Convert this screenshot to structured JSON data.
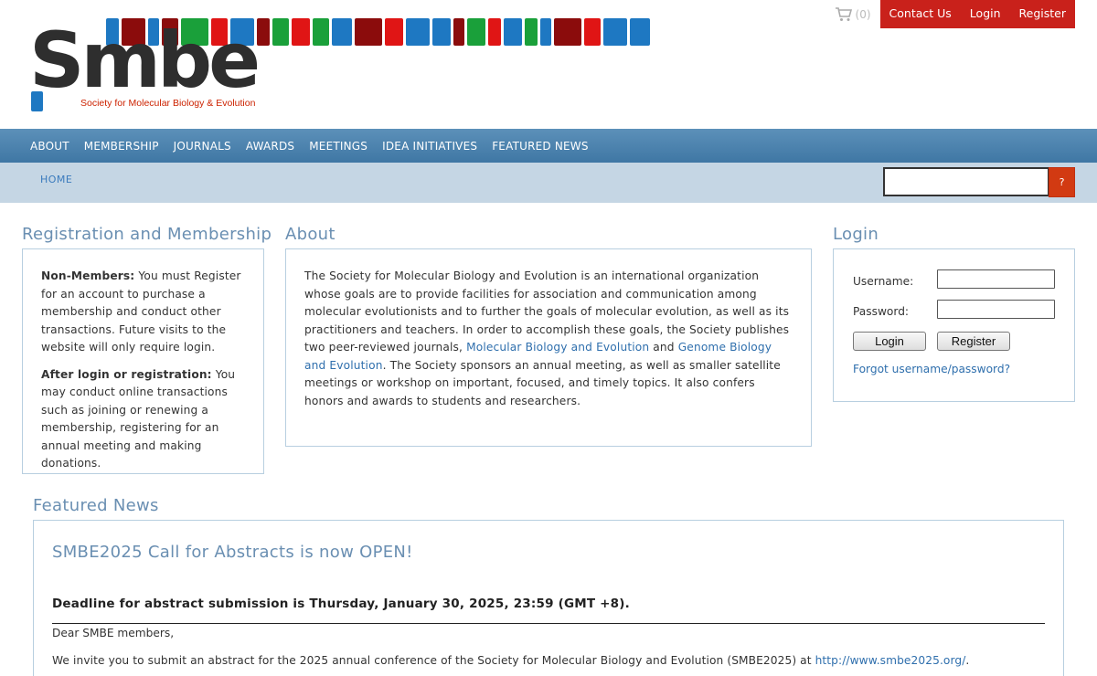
{
  "brand": {
    "wordmark": "Smbe",
    "tagline": "Society for Molecular Biology & Evolution",
    "bar_colors": [
      "#1e78c2",
      "#8b0c0c",
      "#1e78c2",
      "#8b0c0c",
      "#1aa03a",
      "#e01515",
      "#1e78c2",
      "#8b0c0c",
      "#1aa03a",
      "#e01515",
      "#1aa03a",
      "#1e78c2",
      "#8b0c0c",
      "#e01515",
      "#1e78c2",
      "#1e78c2",
      "#8b0c0c",
      "#1aa03a",
      "#e01515",
      "#1e78c2",
      "#1aa03a",
      "#1e78c2",
      "#8b0c0c",
      "#e01515",
      "#1e78c2",
      "#1e78c2"
    ]
  },
  "top_links": {
    "cart_count": "(0)",
    "contact": "Contact Us",
    "login": "Login",
    "register": "Register"
  },
  "nav": [
    "ABOUT",
    "MEMBERSHIP",
    "JOURNALS",
    "AWARDS",
    "MEETINGS",
    "IDEA INITIATIVES",
    "FEATURED NEWS"
  ],
  "breadcrumb": "HOME",
  "search": {
    "button_label": "?"
  },
  "registration": {
    "title": "Registration and Membership",
    "nonmember_label": "Non-Members:",
    "nonmember_text": " You must Register for an account to purchase a membership and conduct other transactions. Future visits to the website will only require login.",
    "after_label": "After login or registration:",
    "after_text": " You may conduct online transactions such as joining or renewing a membership, registering for an annual meeting and making donations."
  },
  "about": {
    "title": "About",
    "text_1": "The Society for Molecular Biology and Evolution is an international organization whose goals are to provide facilities for association and communication among molecular evolutionists and to further the goals of molecular evolution, as well as its practitioners and teachers. In order to accomplish these goals, the Society publishes two peer-reviewed journals, ",
    "link_1": "Molecular Biology and Evolution",
    "text_2": " and ",
    "link_2": "Genome Biology and Evolution",
    "text_3": ". The Society sponsors an annual meeting, as well as smaller satellite meetings or workshop on important, focused, and timely topics. It also confers honors and awards to students and researchers."
  },
  "login": {
    "title": "Login",
    "username_label": "Username:",
    "password_label": "Password:",
    "login_button": "Login",
    "register_button": "Register",
    "forgot": "Forgot username/password?"
  },
  "featured": {
    "title": "Featured News",
    "headline": "SMBE2025 Call for Abstracts is now OPEN!",
    "deadline": "Deadline for abstract submission is Thursday, January 30, 2025, 23:59 (GMT +8).",
    "greeting": "Dear SMBE members,",
    "invite_text": "We invite you to submit an abstract for the 2025 annual conference of the Society for Molecular Biology and Evolution (SMBE2025) at ",
    "invite_link": "http://www.smbe2025.org/",
    "invite_end": "."
  }
}
